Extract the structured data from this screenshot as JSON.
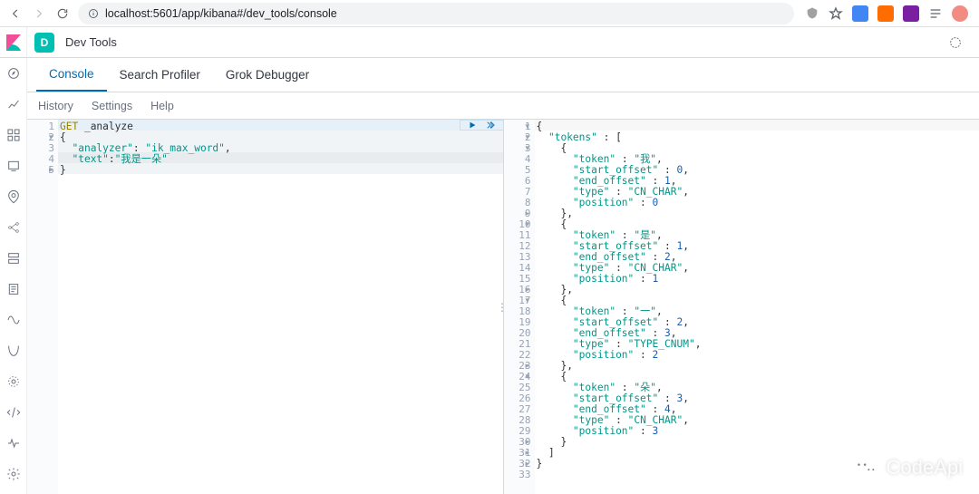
{
  "browser": {
    "url": "localhost:5601/app/kibana#/dev_tools/console"
  },
  "header": {
    "space_initial": "D",
    "breadcrumb": "Dev Tools"
  },
  "tabs": {
    "console": "Console",
    "search_profiler": "Search Profiler",
    "grok": "Grok Debugger"
  },
  "subtabs": {
    "history": "History",
    "settings": "Settings",
    "help": "Help"
  },
  "request": {
    "gutter": [
      "1",
      "2",
      "3",
      "4",
      "5"
    ],
    "folds": [
      null,
      "▾",
      null,
      null,
      "▸"
    ],
    "raw": "GET _analyze\n{\n  \"analyzer\": \"ik_max_word\",\n  \"text\":\"我是一朵\"\n}",
    "method": "GET",
    "path": "_analyze",
    "body_lines": [
      "{",
      "  \"analyzer\": \"ik_max_word\",",
      "  \"text\":\"我是一朵\"",
      "}"
    ]
  },
  "response": {
    "gutter": [
      "1",
      "2",
      "3",
      "4",
      "5",
      "6",
      "7",
      "8",
      "9",
      "10",
      "11",
      "12",
      "13",
      "14",
      "15",
      "16",
      "17",
      "18",
      "19",
      "20",
      "21",
      "22",
      "23",
      "24",
      "25",
      "26",
      "27",
      "28",
      "29",
      "30",
      "31",
      "32",
      "33"
    ],
    "folds": [
      "▾",
      "▾",
      "▾",
      null,
      null,
      null,
      null,
      null,
      "▸",
      "▾",
      null,
      null,
      null,
      null,
      null,
      "▸",
      "▾",
      null,
      null,
      null,
      null,
      null,
      "▸",
      "▾",
      null,
      null,
      null,
      null,
      null,
      "▸",
      "▸",
      "▸",
      null
    ],
    "raw": "{\n  \"tokens\" : [\n    {\n      \"token\" : \"我\",\n      \"start_offset\" : 0,\n      \"end_offset\" : 1,\n      \"type\" : \"CN_CHAR\",\n      \"position\" : 0\n    },\n    {\n      \"token\" : \"是\",\n      \"start_offset\" : 1,\n      \"end_offset\" : 2,\n      \"type\" : \"CN_CHAR\",\n      \"position\" : 1\n    },\n    {\n      \"token\" : \"一\",\n      \"start_offset\" : 2,\n      \"end_offset\" : 3,\n      \"type\" : \"TYPE_CNUM\",\n      \"position\" : 2\n    },\n    {\n      \"token\" : \"朵\",\n      \"start_offset\" : 3,\n      \"end_offset\" : 4,\n      \"type\" : \"CN_CHAR\",\n      \"position\" : 3\n    }\n  ]\n}\n"
  },
  "watermark": {
    "text": "CodeApi"
  }
}
